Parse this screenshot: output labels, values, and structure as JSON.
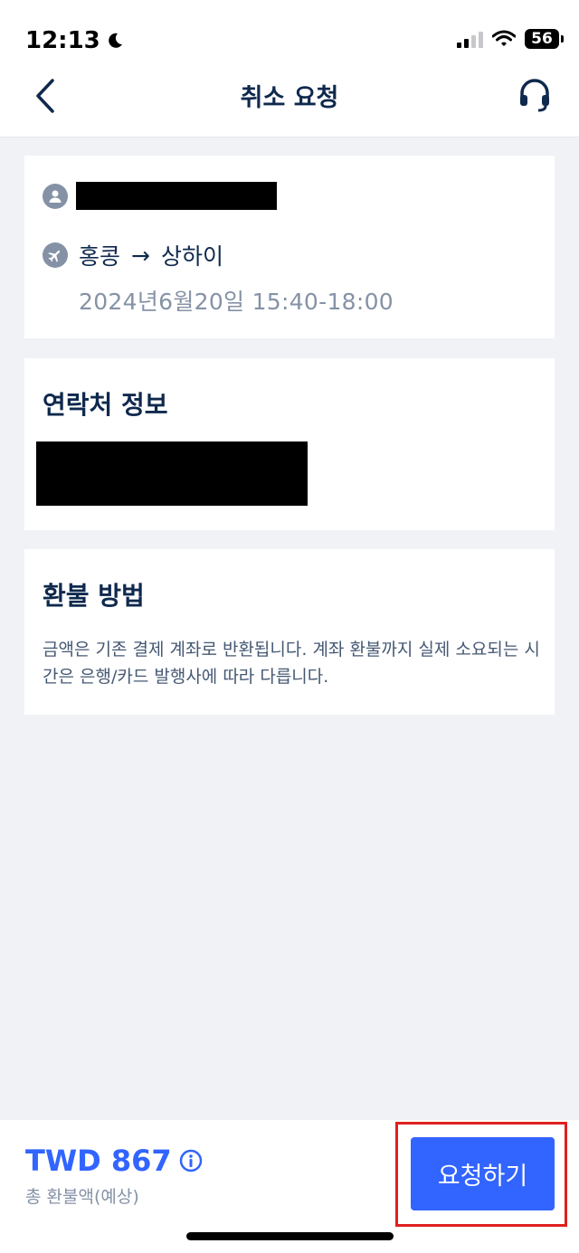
{
  "status": {
    "time": "12:13",
    "battery": "56"
  },
  "header": {
    "title": "취소 요청"
  },
  "booking": {
    "route_from": "홍콩",
    "route_arrow": "→",
    "route_to": "상하이",
    "datetime": "2024년6월20일  15:40-18:00"
  },
  "contact": {
    "title": "연락처 정보"
  },
  "refund": {
    "title": "환불 방법",
    "description": "금액은 기존 결제 계좌로 반환됩니다. 계좌 환불까지 실제 소요되는 시간은 은행/카드 발행사에 따라 다릅니다."
  },
  "footer": {
    "amount": "TWD 867",
    "amount_label": "총 환불액(예상)",
    "request_button": "요청하기"
  },
  "colors": {
    "accent": "#3264ff",
    "highlight": "#e02020",
    "text": "#0f294d",
    "muted": "#8592a6"
  },
  "icons": [
    "moon-icon",
    "signal-icon",
    "wifi-icon",
    "battery-icon",
    "back-chevron-icon",
    "headset-icon",
    "person-icon",
    "airplane-icon",
    "info-icon"
  ]
}
